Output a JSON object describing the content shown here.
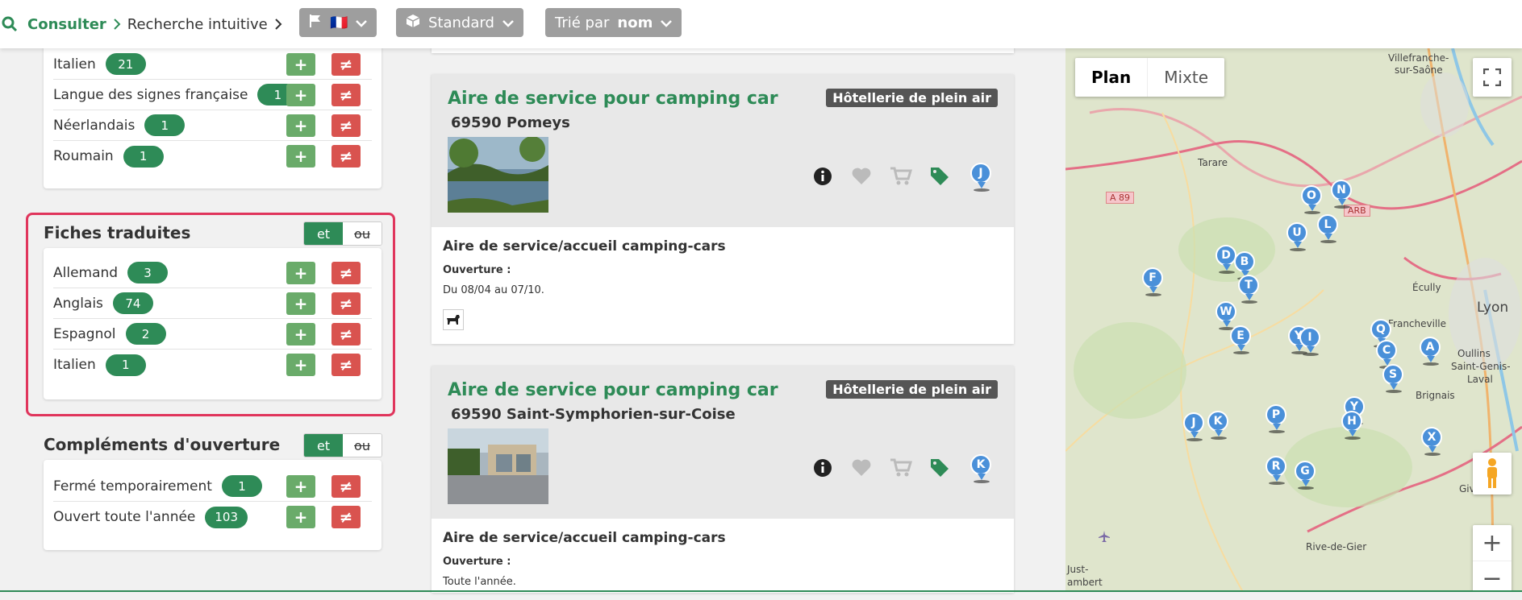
{
  "breadcrumb": {
    "items": [
      "Consulter",
      "Recherche intuitive"
    ]
  },
  "toolbar": {
    "language_flag": "🇫🇷",
    "view_label": "Standard",
    "sort_prefix": "Trié par",
    "sort_value": "nom"
  },
  "languages_section": {
    "items": [
      {
        "label": "Italien",
        "count": "21"
      },
      {
        "label": "Langue des signes française",
        "count": "1"
      },
      {
        "label": "Néerlandais",
        "count": "1"
      },
      {
        "label": "Roumain",
        "count": "1"
      }
    ]
  },
  "translated_section": {
    "title": "Fiches traduites",
    "and_label": "et",
    "or_label": "ou",
    "items": [
      {
        "label": "Allemand",
        "count": "3"
      },
      {
        "label": "Anglais",
        "count": "74"
      },
      {
        "label": "Espagnol",
        "count": "2"
      },
      {
        "label": "Italien",
        "count": "1"
      }
    ]
  },
  "opening_section": {
    "title": "Compléments d'ouverture",
    "and_label": "et",
    "or_label": "ou",
    "items": [
      {
        "label": "Fermé temporairement",
        "count": "1"
      },
      {
        "label": "Ouvert toute l'année",
        "count": "103"
      }
    ]
  },
  "filter_buttons": {
    "include": "+",
    "exclude": "≠"
  },
  "cards": [
    {
      "title": "Aire de service pour camping car",
      "address": "69590 Pomeys",
      "badge": "Hôtellerie de plein air",
      "marker": "J",
      "type": "Aire de service/accueil camping-cars",
      "opening_label": "Ouverture :",
      "opening_value": "Du 08/04 au 07/10."
    },
    {
      "title": "Aire de service pour camping car",
      "address": "69590 Saint-Symphorien-sur-Coise",
      "badge": "Hôtellerie de plein air",
      "marker": "K",
      "type": "Aire de service/accueil camping-cars",
      "opening_label": "Ouverture :",
      "opening_value": "Toute l'année."
    }
  ],
  "map": {
    "plan_label": "Plan",
    "mixed_label": "Mixte",
    "zoom_in": "+",
    "zoom_out": "−",
    "cities": [
      "Villefranche-",
      "sur-Saône",
      "Tarare",
      "Écully",
      "Lyon",
      "Francheville",
      "Oullins",
      "Saint-Genis-",
      "Laval",
      "Brignais",
      "Givors",
      "Rive-de-Gier",
      "Just-",
      "ambert"
    ],
    "roads": [
      "A 89",
      "ARB"
    ],
    "markers": [
      "O",
      "N",
      "U",
      "L",
      "D",
      "B",
      "T",
      "F",
      "W",
      "E",
      "Y",
      "I",
      "Q",
      "C",
      "A",
      "S",
      "Y",
      "H",
      "J",
      "K",
      "P",
      "X",
      "R",
      "G"
    ]
  }
}
